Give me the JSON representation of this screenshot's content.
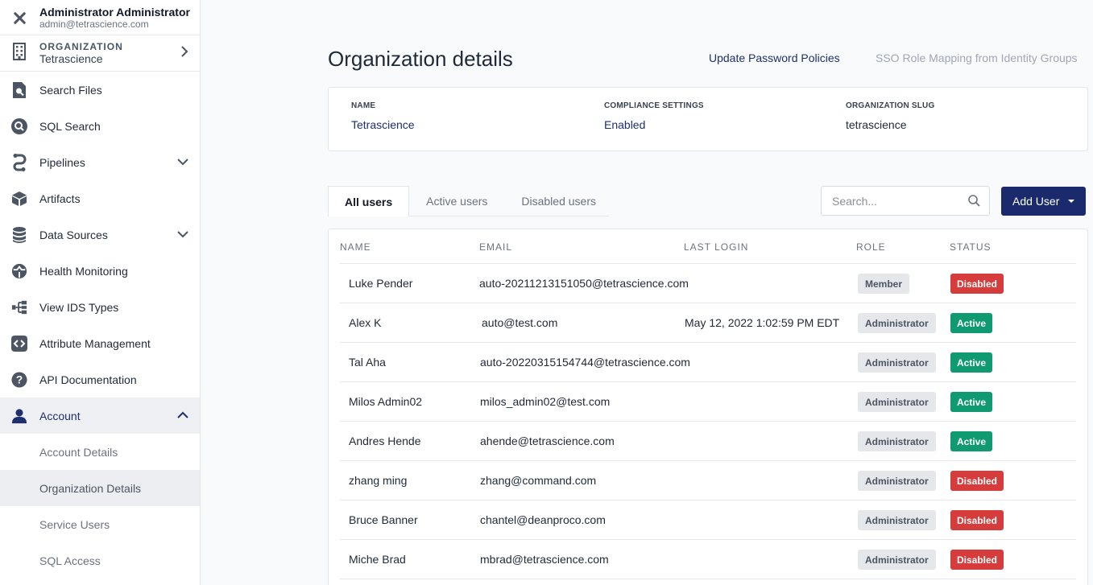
{
  "user": {
    "name": "Administrator Administrator",
    "email": "admin@tetrascience.com"
  },
  "organization": {
    "label": "ORGANIZATION",
    "name": "Tetrascience"
  },
  "nav": [
    {
      "label": "Search Files",
      "icon": "file-search-icon"
    },
    {
      "label": "SQL Search",
      "icon": "search-icon"
    },
    {
      "label": "Pipelines",
      "icon": "pipeline-icon"
    },
    {
      "label": "Artifacts",
      "icon": "cube-icon"
    },
    {
      "label": "Data Sources",
      "icon": "database-icon"
    },
    {
      "label": "Health Monitoring",
      "icon": "health-icon"
    },
    {
      "label": "View IDS Types",
      "icon": "tree-icon"
    },
    {
      "label": "Attribute Management",
      "icon": "code-icon"
    },
    {
      "label": "API Documentation",
      "icon": "help-icon"
    },
    {
      "label": "Account",
      "icon": "person-icon"
    }
  ],
  "account_sub": [
    "Account Details",
    "Organization Details",
    "Service Users",
    "SQL Access"
  ],
  "header": {
    "title": "Organization details",
    "link_password": "Update Password Policies",
    "link_sso": "SSO Role Mapping from Identity Groups"
  },
  "org_card": {
    "name_label": "NAME",
    "name_value": "Tetrascience",
    "compliance_label": "COMPLIANCE SETTINGS",
    "compliance_value": "Enabled",
    "slug_label": "ORGANIZATION SLUG",
    "slug_value": "tetrascience"
  },
  "tabs": [
    "All users",
    "Active users",
    "Disabled users"
  ],
  "search": {
    "placeholder": "Search..."
  },
  "add_user": {
    "label": "Add User"
  },
  "table": {
    "columns": [
      "NAME",
      "EMAIL",
      "LAST LOGIN",
      "ROLE",
      "STATUS"
    ],
    "rows": [
      {
        "name": "Luke Pender",
        "email": "auto-20211213151050@tetrascience.com",
        "last_login": "",
        "role": "Member",
        "status": "Disabled"
      },
      {
        "name": "Alex K",
        "email": "auto@test.com",
        "last_login": "May 12, 2022 1:02:59 PM EDT",
        "role": "Administrator",
        "status": "Active"
      },
      {
        "name": "Tal Aha",
        "email": "auto-20220315154744@tetrascience.com",
        "last_login": "",
        "role": "Administrator",
        "status": "Active"
      },
      {
        "name": "Milos Admin02",
        "email": "milos_admin02@test.com",
        "last_login": "",
        "role": "Administrator",
        "status": "Active"
      },
      {
        "name": "Andres Hende",
        "email": "ahende@tetrascience.com",
        "last_login": "",
        "role": "Administrator",
        "status": "Active"
      },
      {
        "name": "zhang ming",
        "email": "zhang@command.com",
        "last_login": "",
        "role": "Administrator",
        "status": "Disabled"
      },
      {
        "name": "Bruce Banner",
        "email": "chantel@deanproco.com",
        "last_login": "",
        "role": "Administrator",
        "status": "Disabled"
      },
      {
        "name": "Miche  Brad",
        "email": "mbrad@tetrascience.com",
        "last_login": "",
        "role": "Administrator",
        "status": "Disabled"
      }
    ]
  },
  "colors": {
    "accent": "#1a2a6c",
    "active": "#0f9a72",
    "disabled": "#d63c3c"
  }
}
